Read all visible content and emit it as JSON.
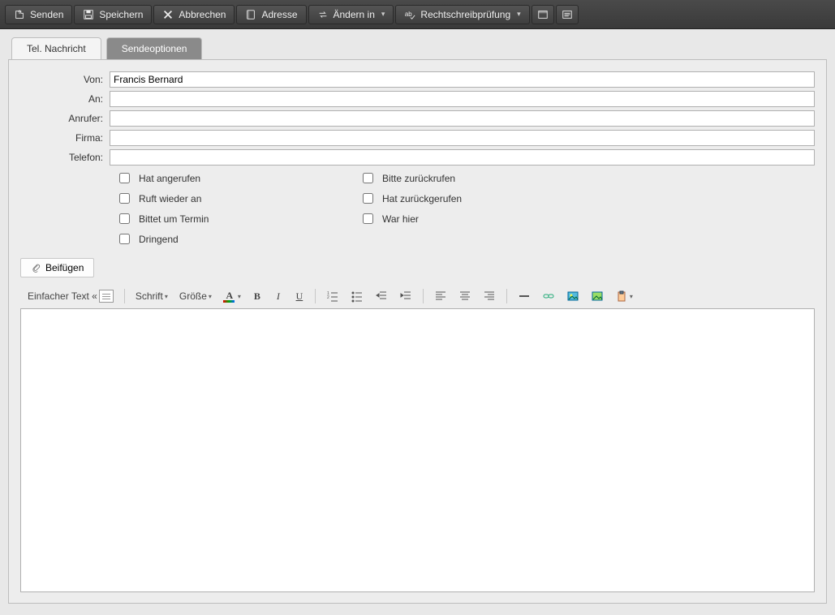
{
  "toolbar": {
    "send": "Senden",
    "save": "Speichern",
    "cancel": "Abbrechen",
    "address": "Adresse",
    "change_to": "Ändern in",
    "spellcheck": "Rechtschreibprüfung"
  },
  "tabs": {
    "message": "Tel. Nachricht",
    "options": "Sendeoptionen"
  },
  "form": {
    "from_label": "Von:",
    "from_value": "Francis Bernard",
    "to_label": "An:",
    "to_value": "",
    "caller_label": "Anrufer:",
    "caller_value": "",
    "company_label": "Firma:",
    "company_value": "",
    "phone_label": "Telefon:",
    "phone_value": ""
  },
  "checks": {
    "called": "Hat angerufen",
    "will_call": "Ruft wieder an",
    "wants_appt": "Bittet um Termin",
    "urgent": "Dringend",
    "please_callback": "Bitte zurückrufen",
    "called_back": "Hat zurückgerufen",
    "was_here": "War hier"
  },
  "attach": {
    "label": "Beifügen"
  },
  "rte": {
    "plain": "Einfacher Text «",
    "font": "Schrift",
    "size": "Größe"
  },
  "body": ""
}
